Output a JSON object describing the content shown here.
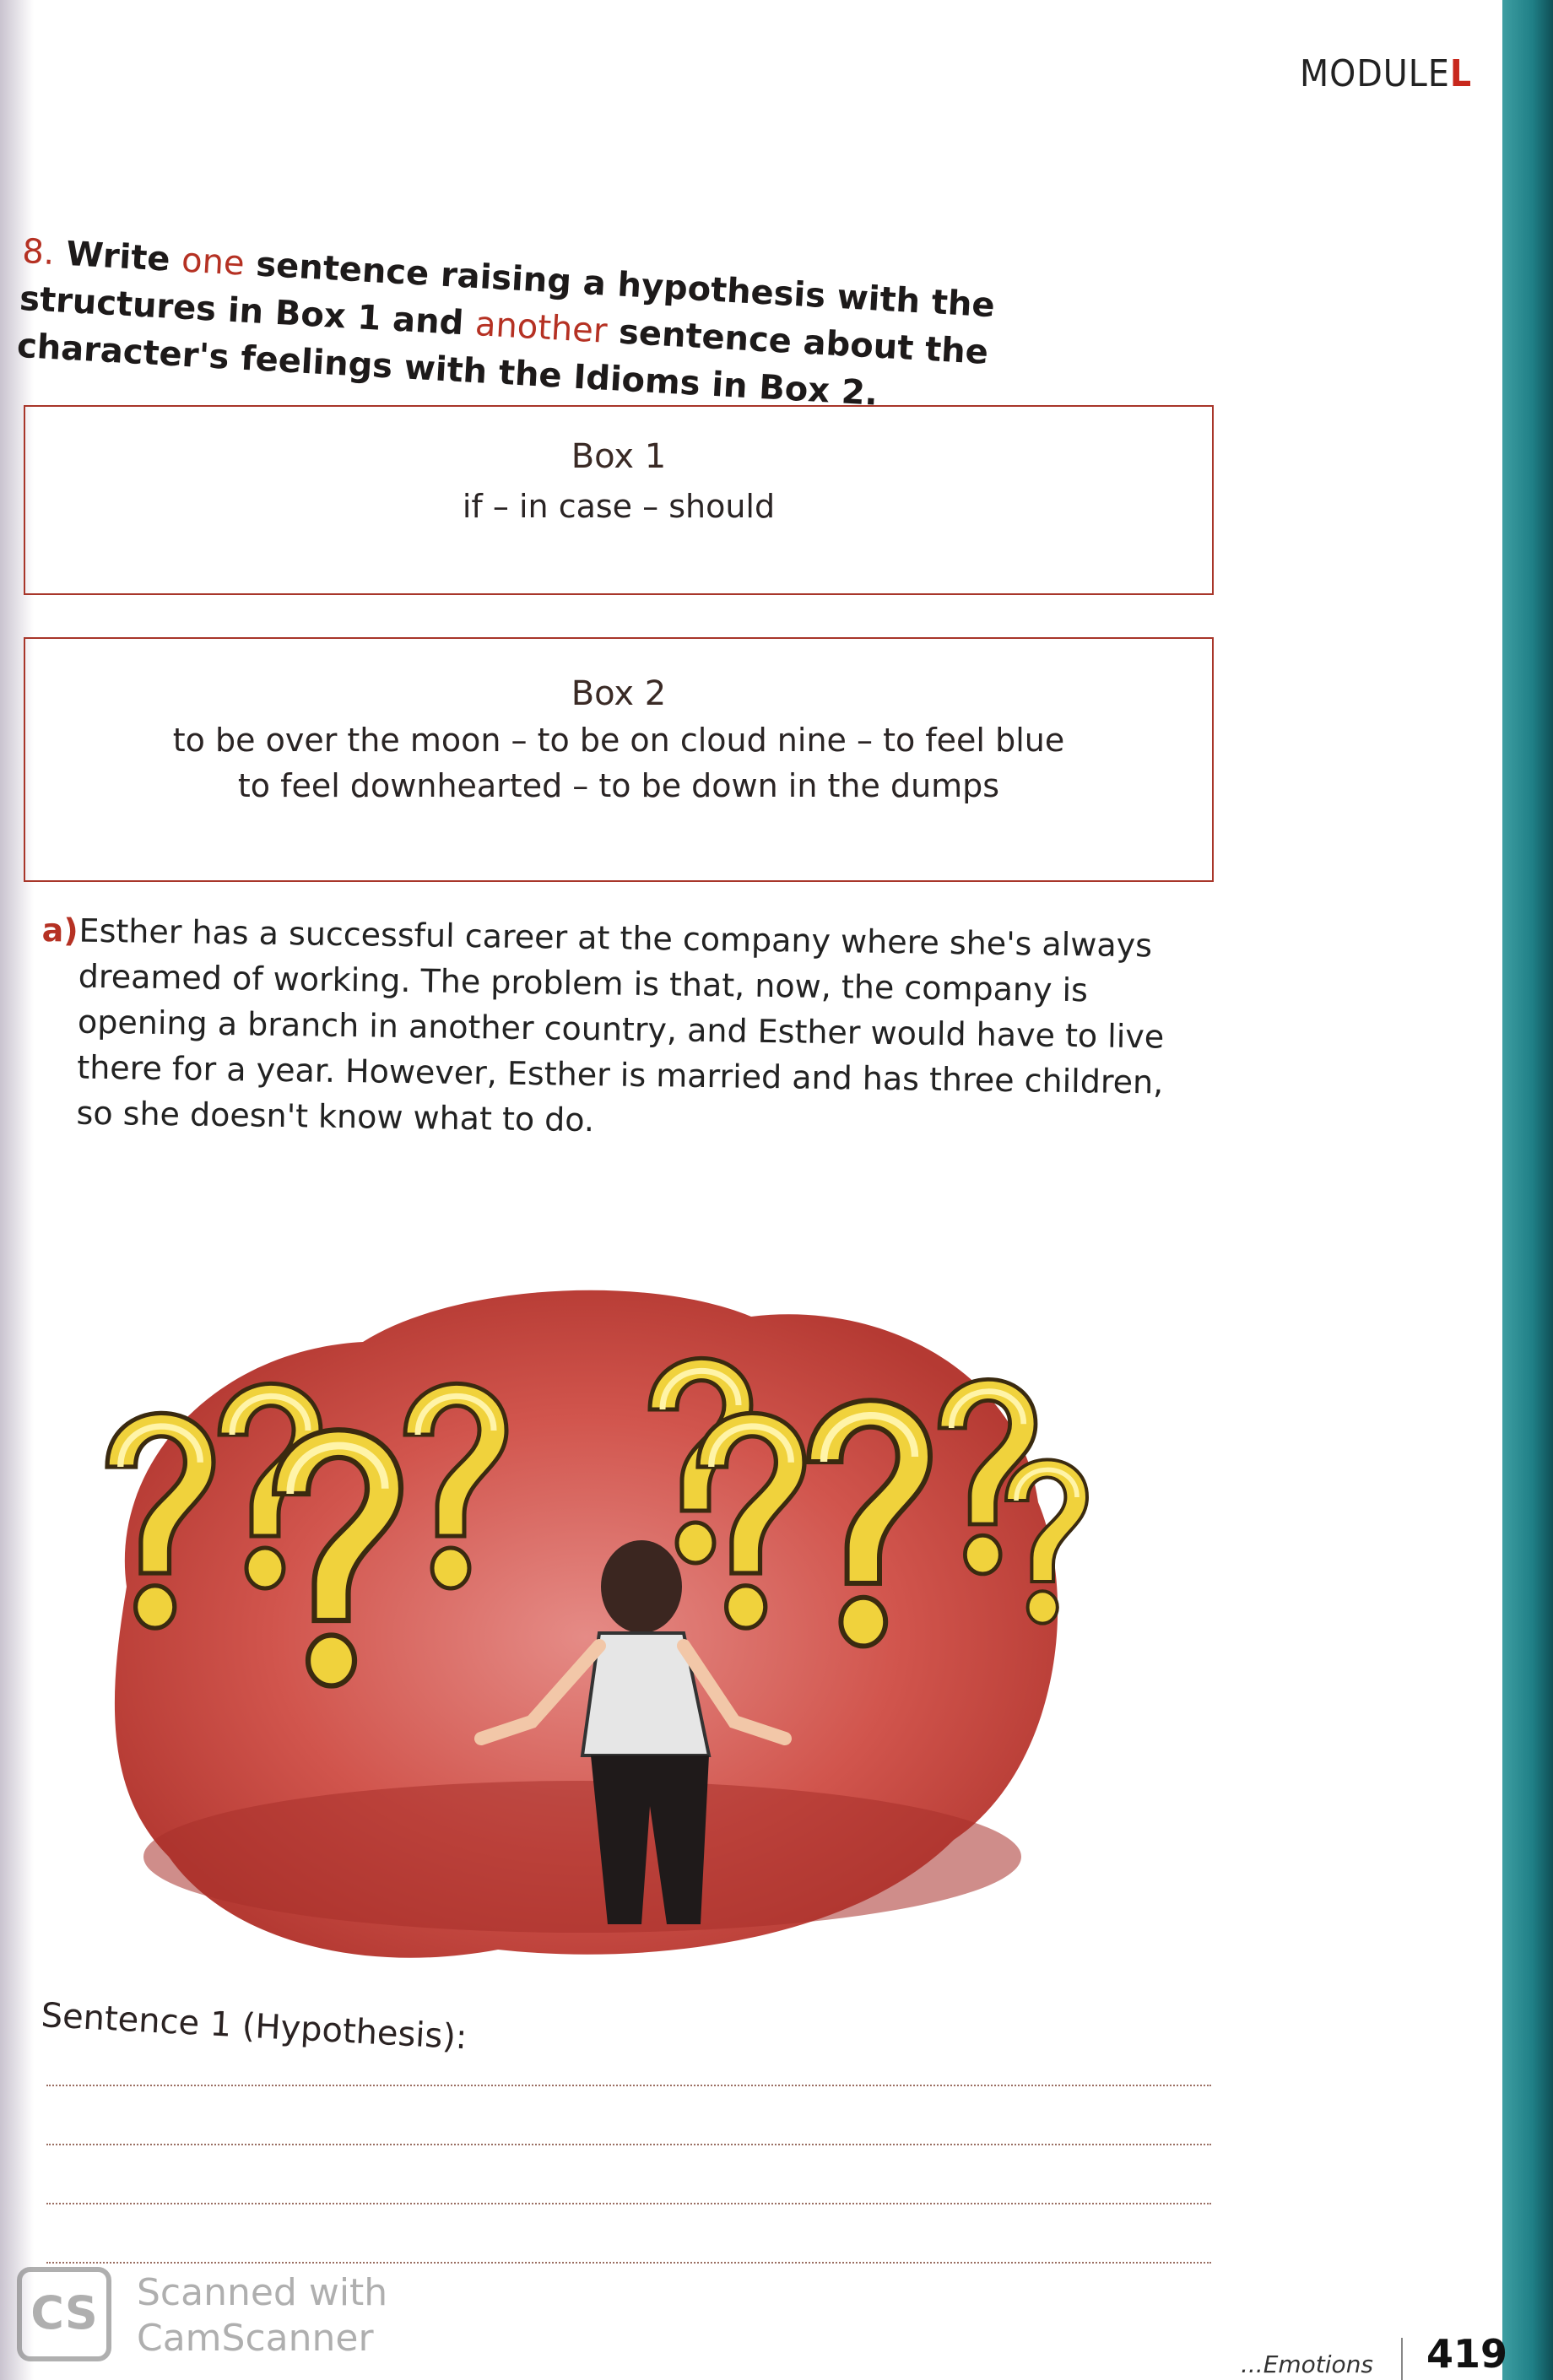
{
  "header": {
    "module_prefix": "MODULE",
    "module_letter": "L"
  },
  "exercise": {
    "number": "8.",
    "instruction_lead": "Write ",
    "instruction_one": "one",
    "instruction_mid": " sentence raising a hypothesis with the structures in Box 1 and ",
    "instruction_another": "another",
    "instruction_tail": " sentence about the character's feelings with the Idioms in Box 2."
  },
  "box1": {
    "title": "Box 1",
    "content": "if – in case – should"
  },
  "box2": {
    "title": "Box 2",
    "line1": "to be over the moon – to be on cloud nine – to feel blue",
    "line2": "to feel downhearted – to be down in the dumps"
  },
  "item_a": {
    "marker": "a)",
    "text": "Esther has a successful career at the company where she's always dreamed of working. The problem is that, now, the company is opening a branch in another country, and Esther would have to live there for a year. However, Esther is married and has three children, so she doesn't know what to do."
  },
  "answer": {
    "label": "Sentence 1 (Hypothesis):"
  },
  "footer": {
    "title": "...Emotions",
    "page_number": "419"
  },
  "watermark": {
    "logo": "CS",
    "line1": "Scanned with",
    "line2": "CamScanner"
  },
  "colors": {
    "accent_red": "#b53123",
    "box_border": "#a8362a",
    "teal_edge": "#1f7f86",
    "question_yellow": "#f0d23c",
    "splash_red": "#c9463f"
  }
}
